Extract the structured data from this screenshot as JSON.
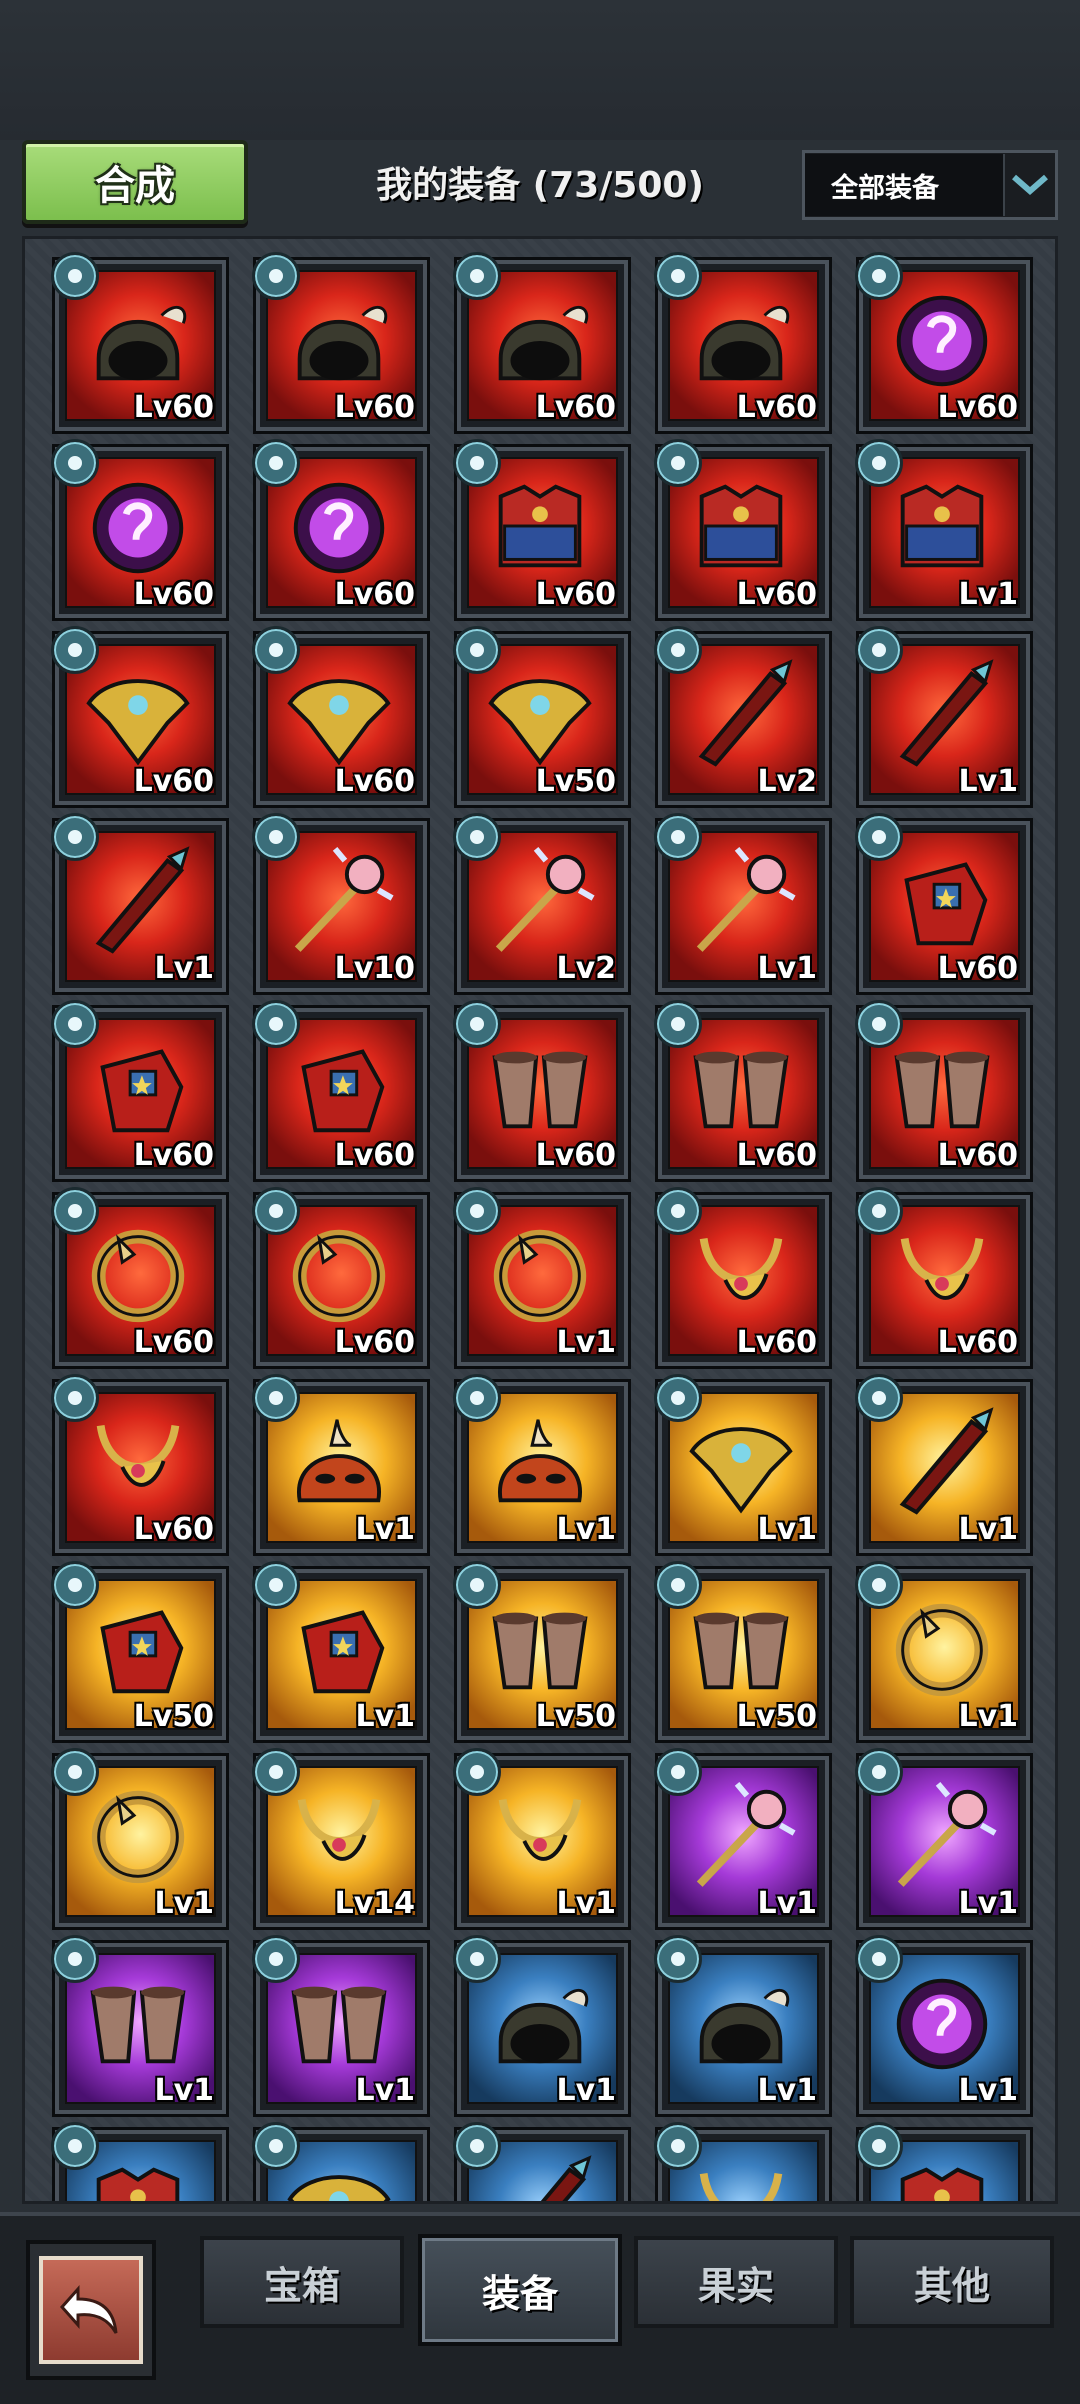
{
  "header": {
    "combine_label": "合成",
    "title": "我的装备 (73/500)",
    "filter_value": "全部装备"
  },
  "rows": [
    [
      {
        "icon": "helmet",
        "level": "Lv60",
        "rarity": "red"
      },
      {
        "icon": "helmet",
        "level": "Lv60",
        "rarity": "red"
      },
      {
        "icon": "helmet",
        "level": "Lv60",
        "rarity": "red"
      },
      {
        "icon": "helmet",
        "level": "Lv60",
        "rarity": "red"
      },
      {
        "icon": "orb",
        "level": "Lv60",
        "rarity": "red"
      }
    ],
    [
      {
        "icon": "orb",
        "level": "Lv60",
        "rarity": "red"
      },
      {
        "icon": "orb",
        "level": "Lv60",
        "rarity": "red"
      },
      {
        "icon": "armor",
        "level": "Lv60",
        "rarity": "red"
      },
      {
        "icon": "armor",
        "level": "Lv60",
        "rarity": "red"
      },
      {
        "icon": "armor",
        "level": "Lv1",
        "rarity": "red"
      }
    ],
    [
      {
        "icon": "shoulder",
        "level": "Lv60",
        "rarity": "red"
      },
      {
        "icon": "shoulder",
        "level": "Lv60",
        "rarity": "red"
      },
      {
        "icon": "shoulder",
        "level": "Lv50",
        "rarity": "red"
      },
      {
        "icon": "sword",
        "level": "Lv2",
        "rarity": "red"
      },
      {
        "icon": "sword",
        "level": "Lv1",
        "rarity": "red"
      }
    ],
    [
      {
        "icon": "sword",
        "level": "Lv1",
        "rarity": "red"
      },
      {
        "icon": "staff",
        "level": "Lv10",
        "rarity": "red"
      },
      {
        "icon": "staff",
        "level": "Lv2",
        "rarity": "red"
      },
      {
        "icon": "staff",
        "level": "Lv1",
        "rarity": "red"
      },
      {
        "icon": "gauntlet",
        "level": "Lv60",
        "rarity": "red"
      }
    ],
    [
      {
        "icon": "gauntlet",
        "level": "Lv60",
        "rarity": "red"
      },
      {
        "icon": "gauntlet",
        "level": "Lv60",
        "rarity": "red"
      },
      {
        "icon": "boots",
        "level": "Lv60",
        "rarity": "red"
      },
      {
        "icon": "boots",
        "level": "Lv60",
        "rarity": "red"
      },
      {
        "icon": "boots",
        "level": "Lv60",
        "rarity": "red"
      }
    ],
    [
      {
        "icon": "ring",
        "level": "Lv60",
        "rarity": "red"
      },
      {
        "icon": "ring",
        "level": "Lv60",
        "rarity": "red"
      },
      {
        "icon": "ring",
        "level": "Lv1",
        "rarity": "red"
      },
      {
        "icon": "necklace",
        "level": "Lv60",
        "rarity": "red"
      },
      {
        "icon": "necklace",
        "level": "Lv60",
        "rarity": "red"
      }
    ],
    [
      {
        "icon": "necklace",
        "level": "Lv60",
        "rarity": "red"
      },
      {
        "icon": "mask",
        "level": "Lv1",
        "rarity": "gold"
      },
      {
        "icon": "mask",
        "level": "Lv1",
        "rarity": "gold"
      },
      {
        "icon": "shoulder",
        "level": "Lv1",
        "rarity": "gold"
      },
      {
        "icon": "sword",
        "level": "Lv1",
        "rarity": "gold"
      }
    ],
    [
      {
        "icon": "gauntlet",
        "level": "Lv50",
        "rarity": "gold"
      },
      {
        "icon": "gauntlet",
        "level": "Lv1",
        "rarity": "gold"
      },
      {
        "icon": "boots",
        "level": "Lv50",
        "rarity": "gold"
      },
      {
        "icon": "boots",
        "level": "Lv50",
        "rarity": "gold"
      },
      {
        "icon": "ring",
        "level": "Lv1",
        "rarity": "gold"
      }
    ],
    [
      {
        "icon": "ring",
        "level": "Lv1",
        "rarity": "gold"
      },
      {
        "icon": "necklace",
        "level": "Lv14",
        "rarity": "gold"
      },
      {
        "icon": "necklace",
        "level": "Lv1",
        "rarity": "gold"
      },
      {
        "icon": "staff",
        "level": "Lv1",
        "rarity": "purple"
      },
      {
        "icon": "staff",
        "level": "Lv1",
        "rarity": "purple"
      }
    ],
    [
      {
        "icon": "boots",
        "level": "Lv1",
        "rarity": "purple"
      },
      {
        "icon": "boots",
        "level": "Lv1",
        "rarity": "purple"
      },
      {
        "icon": "helmet",
        "level": "Lv1",
        "rarity": "blue"
      },
      {
        "icon": "helmet",
        "level": "Lv1",
        "rarity": "blue"
      },
      {
        "icon": "orb",
        "level": "Lv1",
        "rarity": "blue"
      }
    ],
    [
      {
        "icon": "armor",
        "level": "",
        "rarity": "blue"
      },
      {
        "icon": "shoulder",
        "level": "",
        "rarity": "blue"
      },
      {
        "icon": "sword",
        "level": "",
        "rarity": "blue"
      },
      {
        "icon": "necklace",
        "level": "",
        "rarity": "blue"
      },
      {
        "icon": "armor",
        "level": "",
        "rarity": "blue"
      }
    ]
  ],
  "tabs": [
    {
      "label": "宝箱",
      "active": false
    },
    {
      "label": "装备",
      "active": true
    },
    {
      "label": "果实",
      "active": false
    },
    {
      "label": "其他",
      "active": false
    }
  ],
  "colors": {
    "accent_green": "#8fd05e",
    "rarity_red": "#d9261a",
    "rarity_gold": "#f6b426",
    "rarity_purple": "#a53ad8",
    "rarity_blue": "#3a7fc0"
  }
}
